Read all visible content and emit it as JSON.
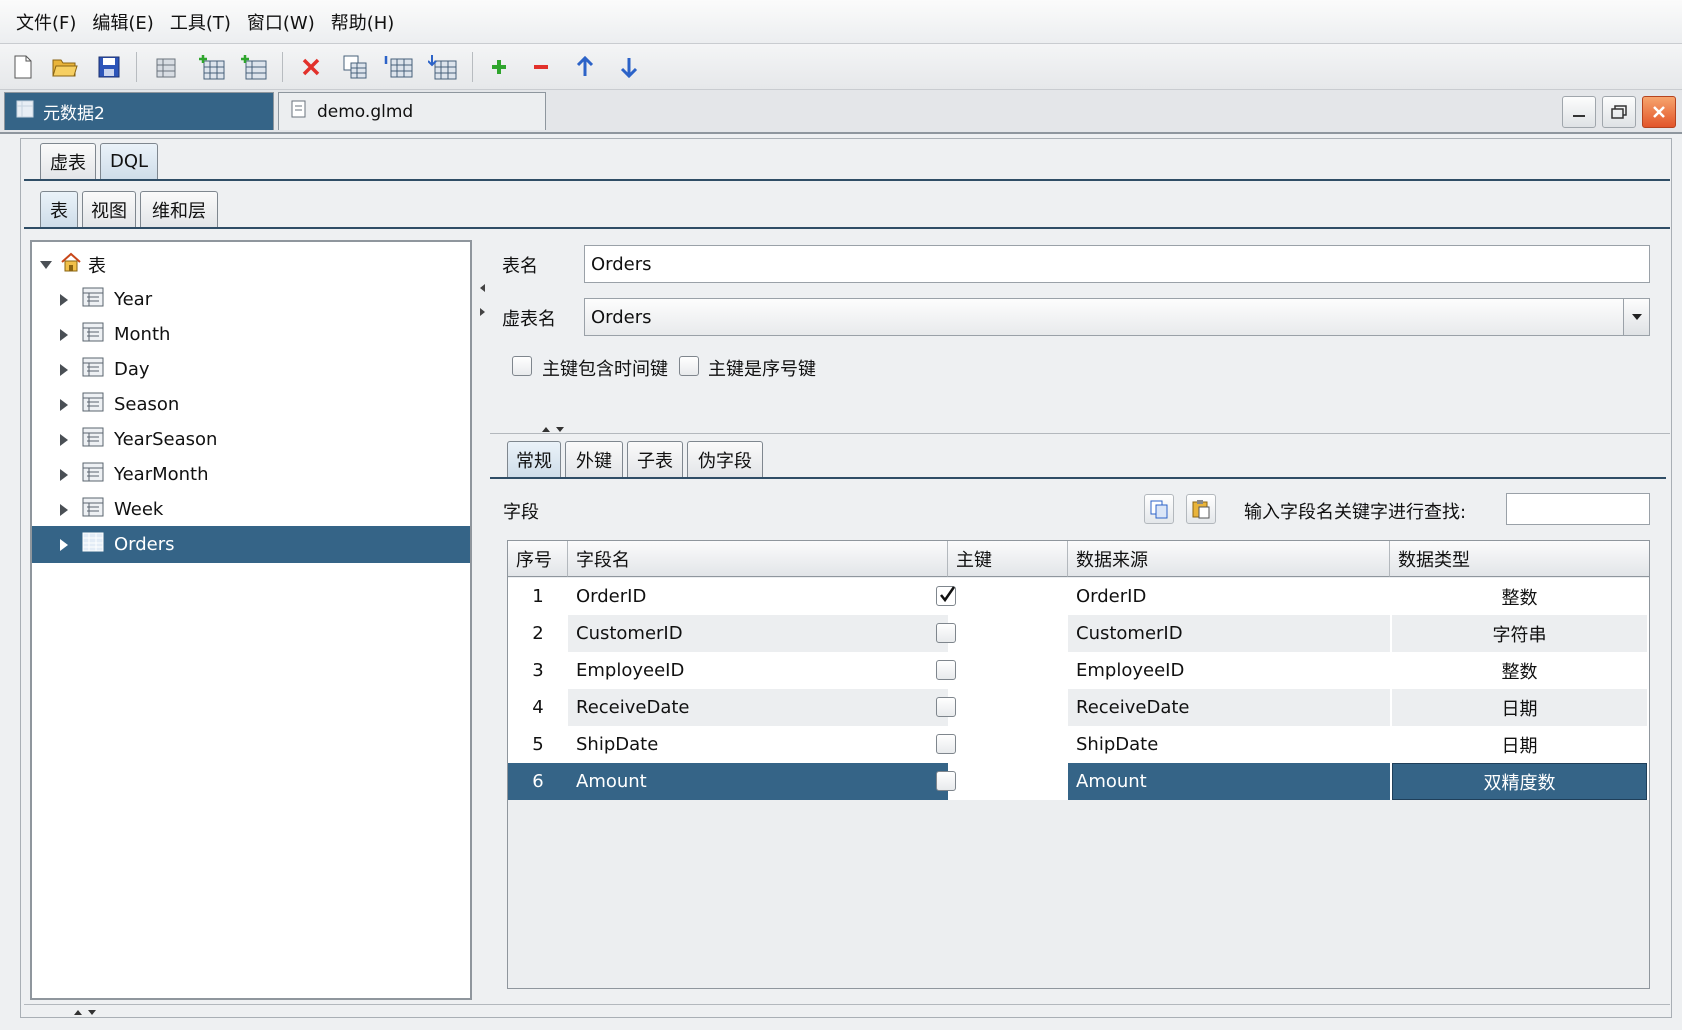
{
  "menu": [
    "文件(F)",
    "编辑(E)",
    "工具(T)",
    "窗口(W)",
    "帮助(H)"
  ],
  "toolbar_icons": [
    "new-file-icon",
    "open-folder-icon",
    "save-icon",
    "table-icon",
    "add-table-icon",
    "add-view-icon",
    "delete-icon",
    "copy-table-icon",
    "import-table-icon",
    "export-table-icon",
    "add-row-icon",
    "remove-row-icon",
    "move-up-icon",
    "move-down-icon"
  ],
  "doc_tabs": [
    {
      "label": "元数据2",
      "active": true
    },
    {
      "label": "demo.glmd",
      "active": false
    }
  ],
  "top_tabs": [
    "虚表",
    "DQL"
  ],
  "sub_tabs": [
    "表",
    "视图",
    "维和层"
  ],
  "tree": {
    "root": "表",
    "items": [
      "Year",
      "Month",
      "Day",
      "Season",
      "YearSeason",
      "YearMonth",
      "Week",
      "Orders"
    ],
    "selected": "Orders"
  },
  "form": {
    "table_name_label": "表名",
    "table_name_value": "Orders",
    "virtual_name_label": "虚表名",
    "virtual_name_value": "Orders",
    "check1_label": "主键包含时间键",
    "check2_label": "主键是序号键"
  },
  "detail_tabs": [
    "常规",
    "外键",
    "子表",
    "伪字段"
  ],
  "fields": {
    "label": "字段",
    "search_label": "输入字段名关键字进行查找:",
    "search_value": "",
    "columns": [
      "序号",
      "字段名",
      "主键",
      "数据来源",
      "数据类型"
    ],
    "rows": [
      {
        "no": "1",
        "name": "OrderID",
        "pk": true,
        "source": "OrderID",
        "type": "整数"
      },
      {
        "no": "2",
        "name": "CustomerID",
        "pk": false,
        "source": "CustomerID",
        "type": "字符串"
      },
      {
        "no": "3",
        "name": "EmployeeID",
        "pk": false,
        "source": "EmployeeID",
        "type": "整数"
      },
      {
        "no": "4",
        "name": "ReceiveDate",
        "pk": false,
        "source": "ReceiveDate",
        "type": "日期"
      },
      {
        "no": "5",
        "name": "ShipDate",
        "pk": false,
        "source": "ShipDate",
        "type": "日期"
      },
      {
        "no": "6",
        "name": "Amount",
        "pk": false,
        "source": "Amount",
        "type": "双精度数"
      }
    ],
    "selected_row": "6"
  },
  "colors": {
    "selection": "#356487",
    "accent_red": "#e2312b",
    "accent_green": "#2fa52d",
    "accent_blue": "#2c63c8"
  }
}
